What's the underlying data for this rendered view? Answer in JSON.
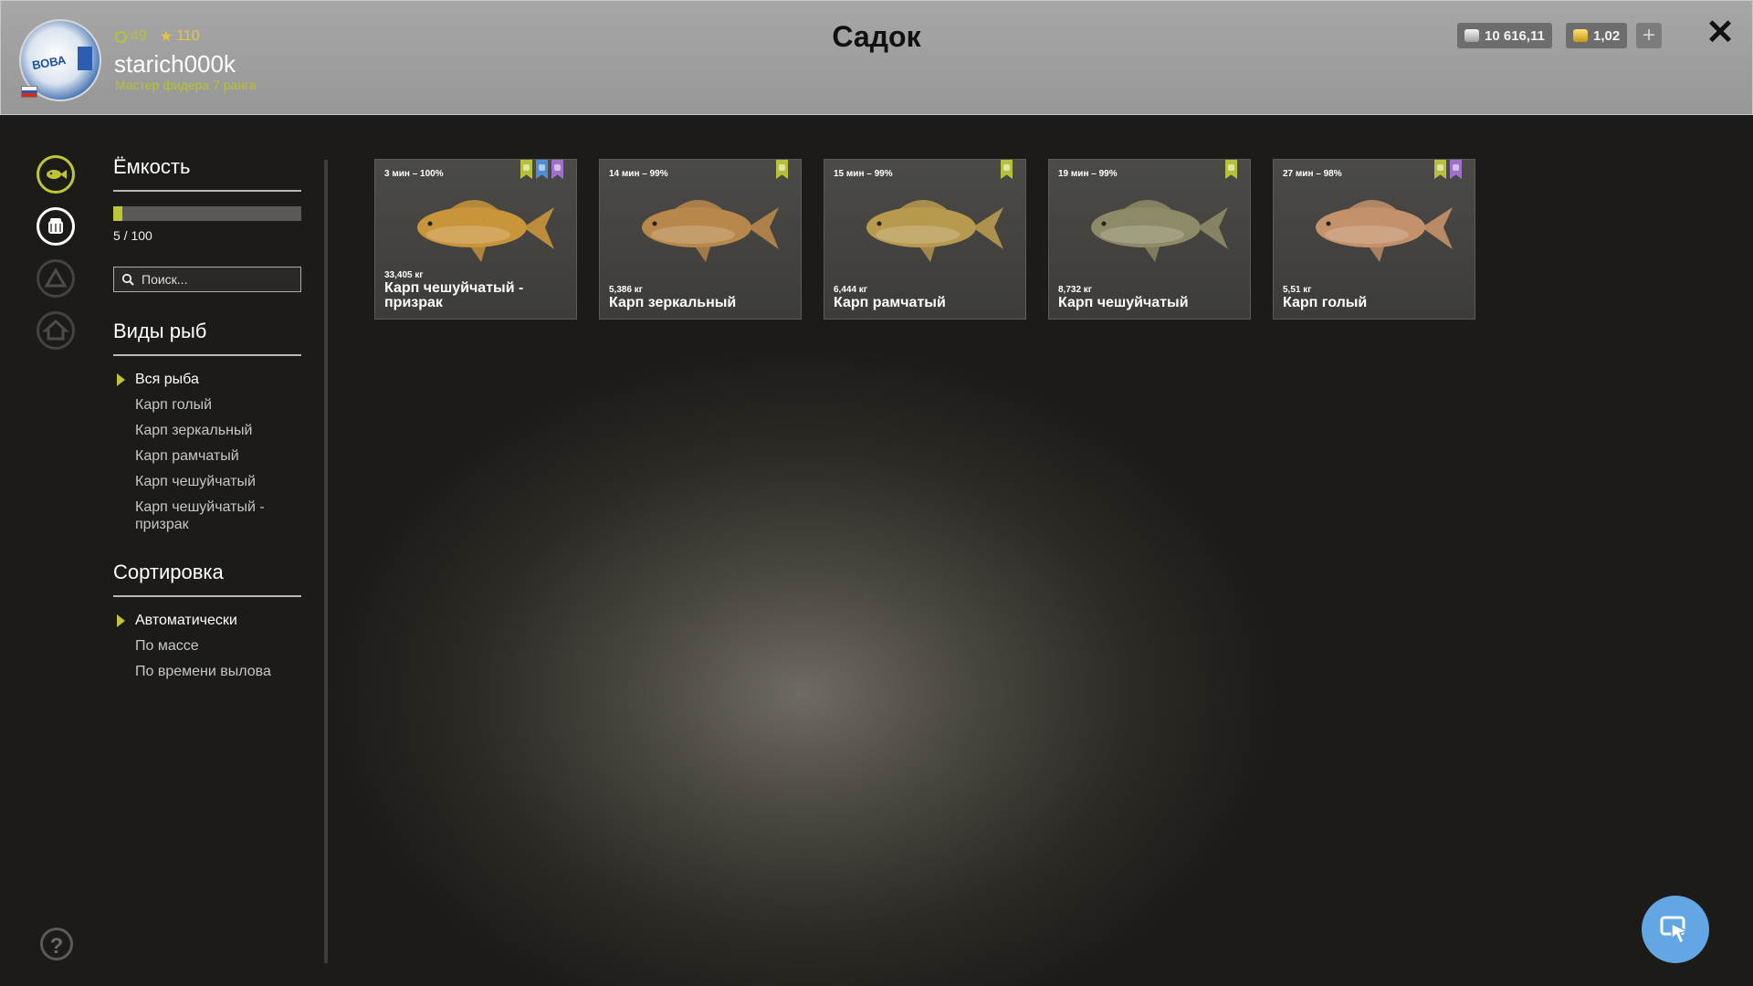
{
  "header": {
    "title": "Садок",
    "level": "49",
    "stars": "110",
    "username": "starich000k",
    "rank": "Мастер фидера 7 ранга",
    "avatar_text": "ВОВА",
    "silver": "10 616,11",
    "gold": "1,02",
    "plus": "+",
    "close": "✕"
  },
  "capacity": {
    "title": "Ёмкость",
    "text": "5 / 100",
    "fraction": 0.05
  },
  "search": {
    "placeholder": "Поиск..."
  },
  "species": {
    "title": "Виды рыб",
    "items": [
      {
        "label": "Вся рыба"
      },
      {
        "label": "Карп голый"
      },
      {
        "label": "Карп зеркальный"
      },
      {
        "label": "Карп рамчатый"
      },
      {
        "label": "Карп чешуйчатый"
      },
      {
        "label": "Карп чешуйчатый - призрак"
      }
    ]
  },
  "sorting": {
    "title": "Сортировка",
    "items": [
      {
        "label": "Автоматически"
      },
      {
        "label": "По массе"
      },
      {
        "label": "По времени вылова"
      }
    ]
  },
  "fish": [
    {
      "meta": "3 мин – 100%",
      "weight": "33,405 кг",
      "name": "Карп чешуйчатый - призрак",
      "marks": [
        "green",
        "blue",
        "purple"
      ],
      "color": "#c9953b"
    },
    {
      "meta": "14 мин – 99%",
      "weight": "5,386 кг",
      "name": "Карп зеркальный",
      "marks": [
        "green"
      ],
      "color": "#b8884a"
    },
    {
      "meta": "15 мин – 99%",
      "weight": "6,444 кг",
      "name": "Карп рамчатый",
      "marks": [
        "green"
      ],
      "color": "#b89a4f"
    },
    {
      "meta": "19 мин – 99%",
      "weight": "8,732 кг",
      "name": "Карп чешуйчатый",
      "marks": [
        "green"
      ],
      "color": "#8d8a67"
    },
    {
      "meta": "27 мин – 98%",
      "weight": "5,51 кг",
      "name": "Карп голый",
      "marks": [
        "green",
        "purple"
      ],
      "color": "#c4926a"
    }
  ],
  "help": "?"
}
